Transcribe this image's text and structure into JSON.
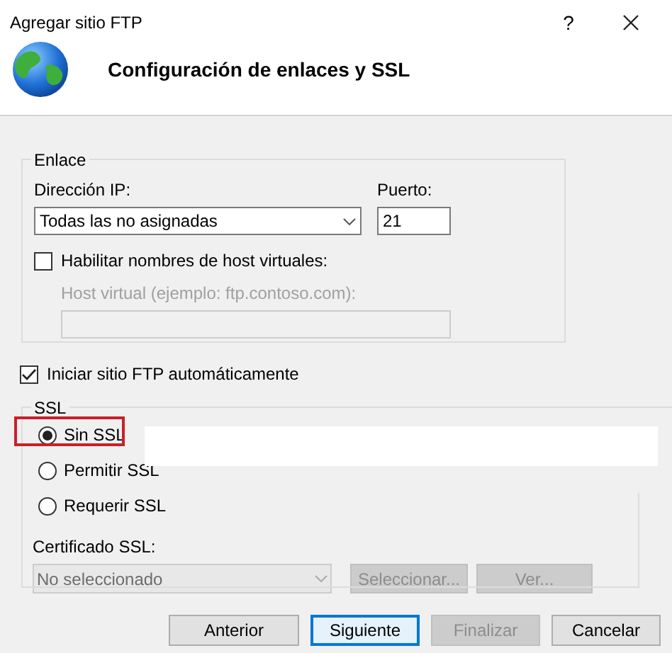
{
  "window": {
    "title": "Agregar sitio FTP",
    "help": "?"
  },
  "header": {
    "title": "Configuración de enlaces y SSL"
  },
  "binding": {
    "legend": "Enlace",
    "ip_label": "Dirección IP:",
    "ip_value": "Todas las no asignadas",
    "port_label": "Puerto:",
    "port_value": "21",
    "virtual_host": {
      "label": "Habilitar nombres de host virtuales:",
      "checked": false
    },
    "host_label": "Host virtual (ejemplo: ftp.contoso.com):",
    "host_disabled": true
  },
  "autostart": {
    "label": "Iniciar sitio FTP automáticamente",
    "checked": true
  },
  "ssl": {
    "legend": "SSL",
    "options": [
      {
        "label": "Sin SSL",
        "selected": true
      },
      {
        "label": "Permitir SSL",
        "selected": false
      },
      {
        "label": "Requerir SSL",
        "selected": false
      }
    ],
    "cert_label": "Certificado SSL:",
    "cert_value": "No seleccionado",
    "cert_disabled": true,
    "buttons": [
      {
        "label": "Seleccionar...",
        "disabled": true
      },
      {
        "label": "Ver...",
        "disabled": true
      }
    ]
  },
  "footer": {
    "buttons": [
      {
        "label": "Anterior",
        "disabled": false,
        "focused": false
      },
      {
        "label": "Siguiente",
        "disabled": false,
        "focused": true
      },
      {
        "label": "Finalizar",
        "disabled": true,
        "focused": false
      },
      {
        "label": "Cancelar",
        "disabled": false,
        "focused": false
      }
    ]
  }
}
